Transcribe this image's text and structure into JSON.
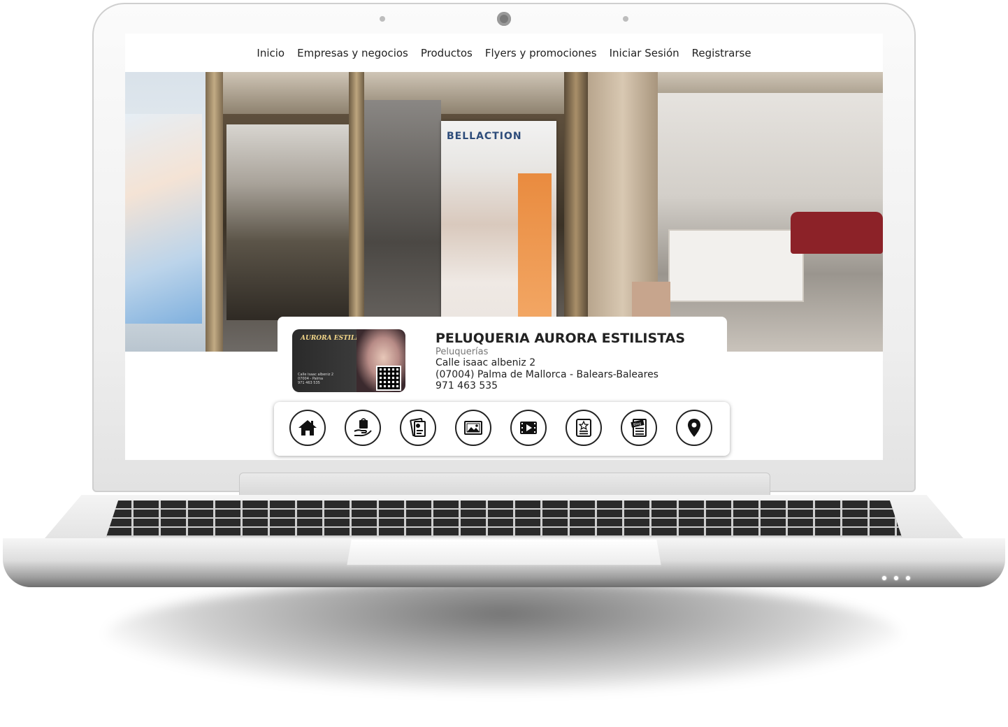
{
  "nav": {
    "items": [
      "Inicio",
      "Empresas y negocios",
      "Productos",
      "Flyers y promociones",
      "Iniciar Sesión",
      "Registrarse"
    ]
  },
  "business": {
    "name": "PELUQUERIA AURORA ESTILISTAS",
    "category": "Peluquerías",
    "address_line1": "Calle isaac albeniz 2",
    "address_line2": "(07004) Palma de Mallorca - Balears-Baleares",
    "phone": "971 463 535"
  },
  "icons": [
    "home-icon",
    "products-icon",
    "flyers-icon",
    "gallery-icon",
    "video-icon",
    "reviews-icon",
    "blog-icon",
    "location-icon"
  ],
  "colors": {
    "icon_stroke": "#222222",
    "text": "#222222",
    "muted": "#777777"
  }
}
